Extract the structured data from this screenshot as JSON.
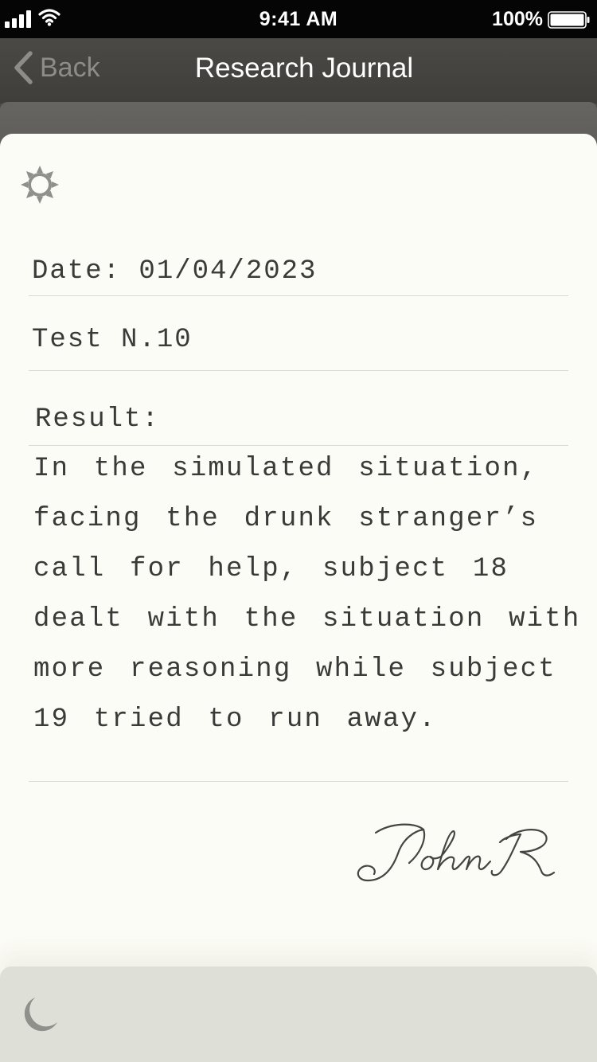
{
  "status_bar": {
    "time": "9:41 AM",
    "battery_percent": "100%",
    "signal_bars": 4,
    "battery_level": 1.0,
    "icons": [
      "signal-icon",
      "wifi-icon",
      "battery-icon"
    ]
  },
  "nav": {
    "back_label": "Back",
    "title": "Research Journal",
    "icons": [
      "chevron-left-icon"
    ]
  },
  "journal": {
    "theme_icon": "sun-icon",
    "date": "Date: 01/04/2023",
    "test": "Test N.10",
    "result_label": "Result:",
    "result_text": "In the simulated situation, facing the drunk stranger’s call for help, subject 18 dealt with the situation with more reasoning while subject 19 tried to run away.",
    "signature": "John R"
  },
  "toolbar": {
    "night_mode_icon": "moon-icon"
  },
  "colors": {
    "status_bar": "#050505",
    "nav_bar": "#454441",
    "paper": "#fcfcf6",
    "ink": "#3a3a38",
    "toolbar": "#dedfd6"
  }
}
